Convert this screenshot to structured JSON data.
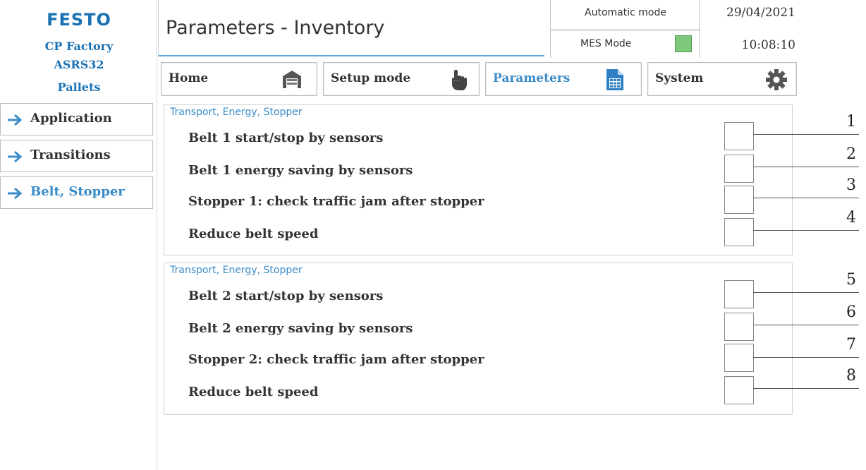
{
  "logo": {
    "brand": "FESTO",
    "line1": "CP Factory",
    "line2": "ASRS32",
    "line3": "Pallets"
  },
  "header": {
    "title": "Parameters - Inventory",
    "mode": "Automatic mode",
    "mes_label": "MES Mode",
    "mes_status_color": "#7dc87a",
    "date": "29/04/2021",
    "time": "10:08:10"
  },
  "nav": [
    {
      "label": "Home",
      "icon": "warehouse-icon"
    },
    {
      "label": "Setup mode",
      "icon": "hand-pointer-icon"
    },
    {
      "label": "Parameters",
      "icon": "document-table-icon",
      "active": true
    },
    {
      "label": "System",
      "icon": "gear-icon"
    }
  ],
  "side_menu": [
    {
      "label": "Application"
    },
    {
      "label": "Transitions"
    },
    {
      "label": "Belt, Stopper",
      "active": true
    }
  ],
  "panels": [
    {
      "heading": "Transport, Energy, Stopper",
      "params": [
        {
          "label": "Belt 1 start/stop by sensors",
          "checked": false,
          "callout": "1"
        },
        {
          "label": "Belt 1  energy saving by sensors",
          "checked": false,
          "callout": "2"
        },
        {
          "label": "Stopper 1: check traffic jam after stopper",
          "checked": false,
          "callout": "3"
        },
        {
          "label": "Reduce belt speed",
          "checked": false,
          "callout": "4"
        }
      ]
    },
    {
      "heading": "Transport, Energy, Stopper",
      "params": [
        {
          "label": "Belt 2 start/stop by sensors",
          "checked": false,
          "callout": "5"
        },
        {
          "label": "Belt 2 energy saving by sensors",
          "checked": false,
          "callout": "6"
        },
        {
          "label": "Stopper 2: check traffic jam after stopper",
          "checked": false,
          "callout": "7"
        },
        {
          "label": "Reduce belt speed",
          "checked": false,
          "callout": "8"
        }
      ]
    }
  ],
  "colors": {
    "accent": "#3a8cc8",
    "brand": "#1a72b4"
  }
}
